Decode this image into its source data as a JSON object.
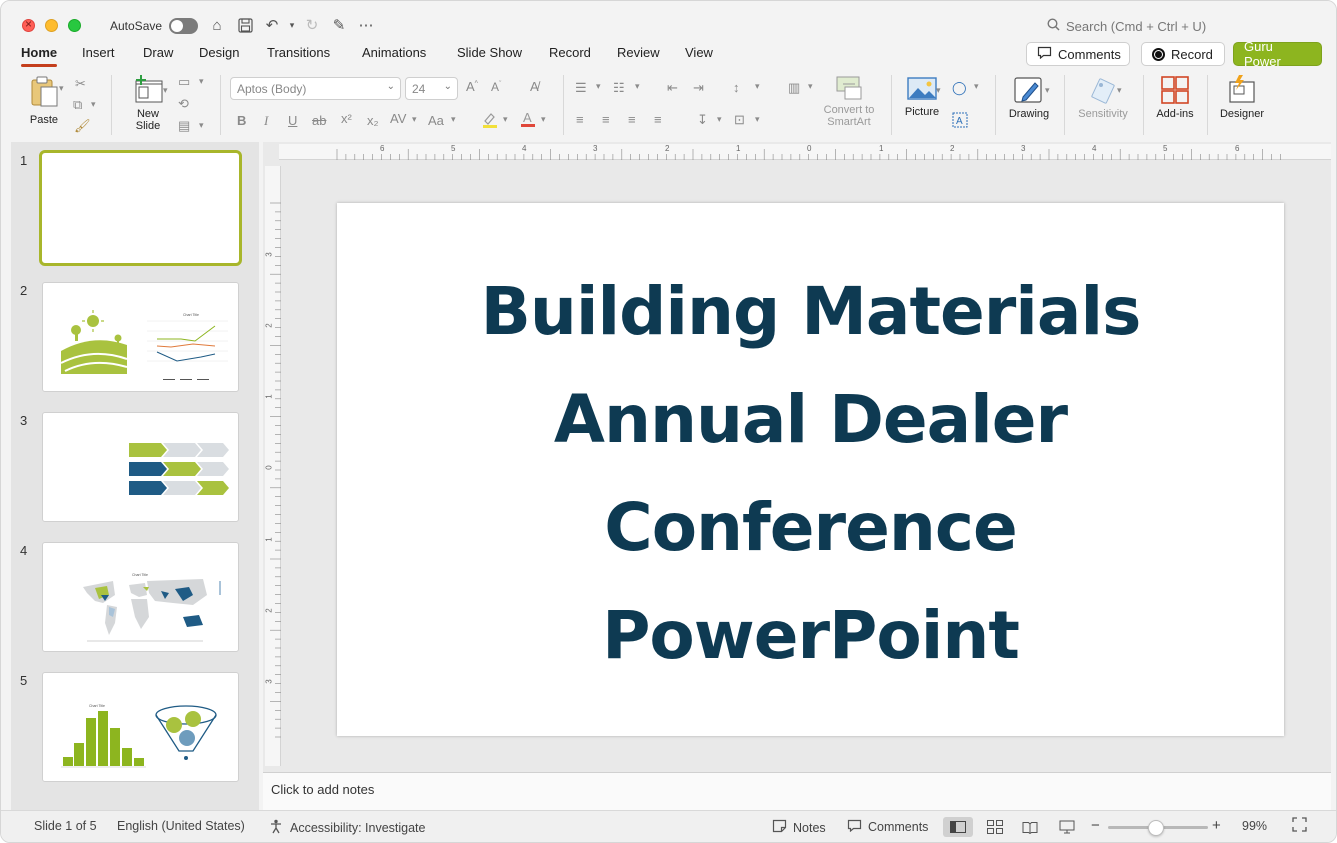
{
  "window": {
    "autosave_label": "AutoSave",
    "search_placeholder": "Search (Cmd + Ctrl + U)"
  },
  "menu": {
    "tabs": [
      "Home",
      "Insert",
      "Draw",
      "Design",
      "Transitions",
      "Animations",
      "Slide Show",
      "Record",
      "Review",
      "View"
    ],
    "active_tab": "Home",
    "comments_label": "Comments",
    "record_label": "Record",
    "guru_label": "Guru Power"
  },
  "ribbon": {
    "paste_label": "Paste",
    "new_slide_label": "New\nSlide",
    "font_name": "Aptos (Body)",
    "font_size": "24",
    "convert_label": "Convert to\nSmartArt",
    "picture_label": "Picture",
    "drawing_label": "Drawing",
    "sensitivity_label": "Sensitivity",
    "addins_label": "Add-ins",
    "designer_label": "Designer"
  },
  "thumbnails": {
    "numbers": [
      "1",
      "2",
      "3",
      "4",
      "5"
    ],
    "chart_title_small": "Chart Title"
  },
  "slide": {
    "title_lines": [
      "Building Materials",
      "Annual Dealer",
      "Conference",
      "PowerPoint"
    ]
  },
  "ruler": {
    "h_labels": [
      "6",
      "5",
      "4",
      "3",
      "2",
      "1",
      "0",
      "1",
      "2",
      "3",
      "4",
      "5",
      "6"
    ],
    "v_labels": [
      "3",
      "2",
      "1",
      "0",
      "1",
      "2",
      "3"
    ]
  },
  "notes": {
    "placeholder": "Click to add notes"
  },
  "status": {
    "slide_indicator": "Slide 1 of 5",
    "language": "English (United States)",
    "accessibility": "Accessibility: Investigate",
    "notes_label": "Notes",
    "comments_label": "Comments",
    "zoom": "99%"
  },
  "colors": {
    "accent_green": "#8db51f",
    "title_navy": "#0e3a52",
    "active_tab_underline": "#c43e1c"
  }
}
